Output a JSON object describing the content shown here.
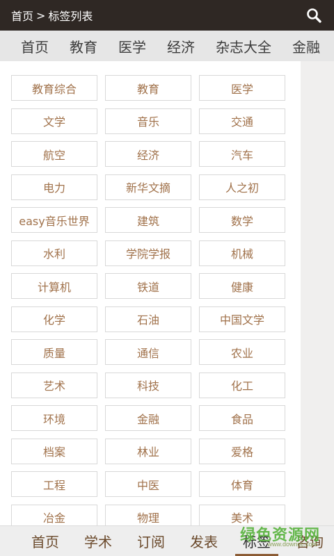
{
  "header": {
    "crumb_home": "首页",
    "crumb_sep": ">",
    "crumb_current": "标签列表",
    "search_icon": "search-icon"
  },
  "categories": [
    "首页",
    "教育",
    "医学",
    "经济",
    "杂志大全",
    "金融"
  ],
  "tags": [
    "教育综合",
    "教育",
    "医学",
    "文学",
    "音乐",
    "交通",
    "航空",
    "经济",
    "汽车",
    "电力",
    "新华文摘",
    "人之初",
    "easy音乐世界",
    "建筑",
    "数学",
    "水利",
    "学院学报",
    "机械",
    "计算机",
    "铁道",
    "健康",
    "化学",
    "石油",
    "中国文学",
    "质量",
    "通信",
    "农业",
    "艺术",
    "科技",
    "化工",
    "环境",
    "金融",
    "食品",
    "档案",
    "林业",
    "爱格",
    "工程",
    "中医",
    "体育",
    "冶金",
    "物理",
    "美术"
  ],
  "bottom_tabs": [
    "首页",
    "学术",
    "订阅",
    "发表",
    "标签",
    "咨询"
  ],
  "active_tab": "标签",
  "watermark": {
    "title": "绿色资源网",
    "subtitle": "www.downcc.com"
  },
  "colors": {
    "topbar": "#2f2824",
    "tag_text": "#a0714a",
    "active_underline": "#8a5a32",
    "watermark": "#57b33c"
  }
}
